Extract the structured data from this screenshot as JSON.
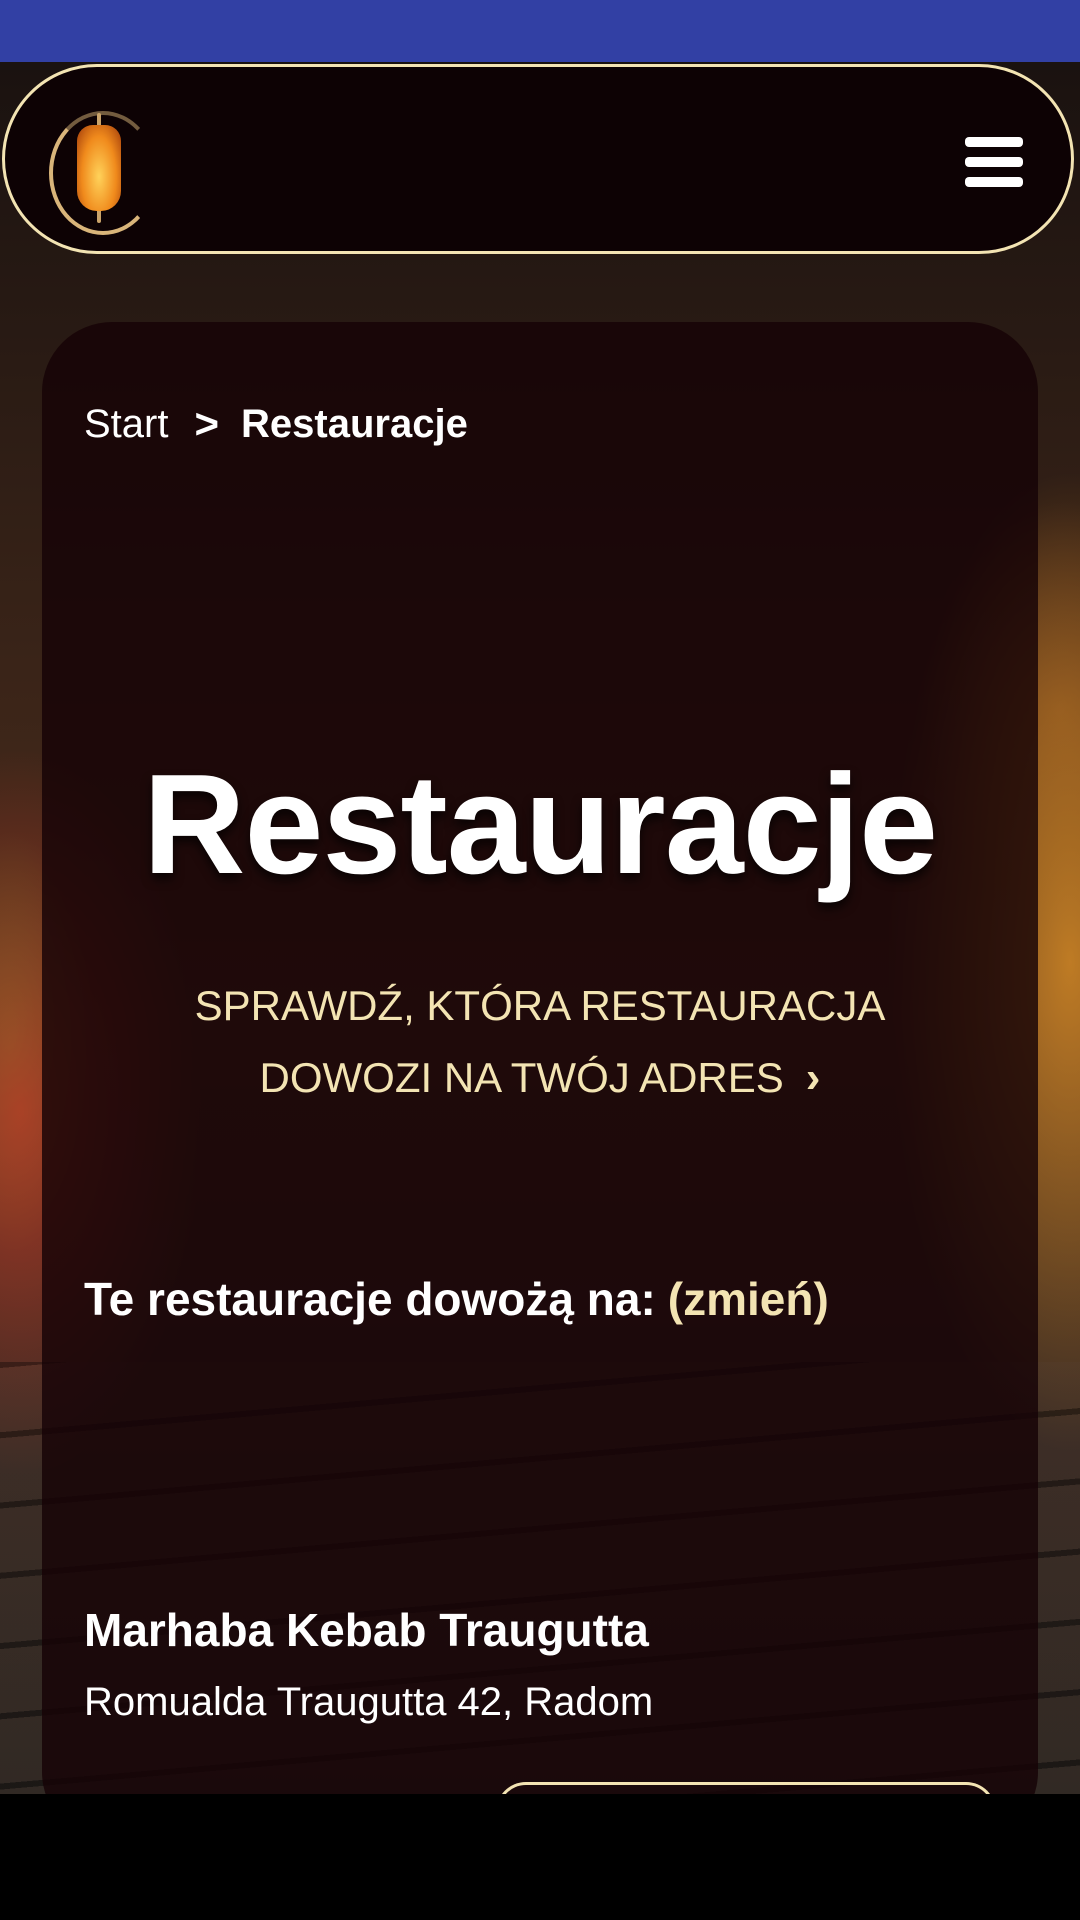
{
  "breadcrumb": {
    "start": "Start",
    "separator": ">",
    "current": "Restauracje"
  },
  "page": {
    "title": "Restauracje"
  },
  "check_address": {
    "line1": "SPRAWDŹ, KTÓRA RESTAURACJA",
    "line2": "DOWOZI NA TWÓJ ADRES",
    "chevron": "›"
  },
  "delivery": {
    "label": "Te restauracje dowożą na:",
    "change": "(zmień)"
  },
  "restaurant": {
    "name": "Marhaba Kebab Traugutta",
    "address": "Romualda Traugutta 42, Radom"
  },
  "colors": {
    "accent": "#f3e4b3",
    "status_bar": "#3240a4",
    "card": "#160306"
  },
  "icons": {
    "logo": "kebab-logo-icon",
    "menu": "hamburger-menu-icon",
    "chevron": "chevron-right-icon"
  }
}
